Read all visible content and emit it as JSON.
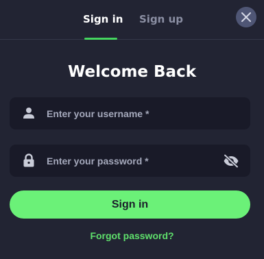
{
  "tabs": [
    {
      "label": "Sign in",
      "active": true
    },
    {
      "label": "Sign up",
      "active": false
    }
  ],
  "close_icon": "close-icon",
  "title": "Welcome Back",
  "username": {
    "icon": "user-icon",
    "placeholder": "Enter your username *",
    "value": ""
  },
  "password": {
    "icon": "lock-icon",
    "placeholder": "Enter your password *",
    "value": "",
    "toggle_icon": "eye-slash-icon"
  },
  "submit_label": "Sign in",
  "forgot_label": "Forgot password?",
  "colors": {
    "background": "#222433",
    "field": "#191a28",
    "accent": "#6bf178",
    "link": "#5fe06c",
    "muted": "#8b8fa3"
  }
}
